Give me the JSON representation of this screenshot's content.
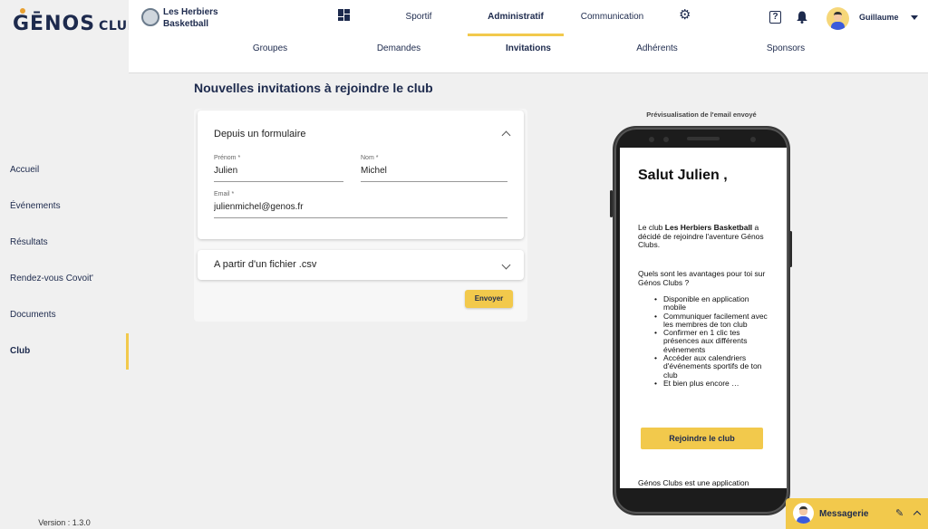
{
  "app": {
    "logo_main": "GĒNOS",
    "logo_sub": "CLUBS",
    "version": "Version : 1.3.0"
  },
  "sidebar": {
    "items": [
      {
        "label": "Accueil"
      },
      {
        "label": "Événements"
      },
      {
        "label": "Résultats"
      },
      {
        "label": "Rendez-vous Covoit'"
      },
      {
        "label": "Documents"
      },
      {
        "label": "Club",
        "active": true
      }
    ]
  },
  "header": {
    "club_name": "Les Herbiers Basketball",
    "tabs": [
      {
        "label": "Sportif"
      },
      {
        "label": "Administratif",
        "active": true
      },
      {
        "label": "Communication"
      }
    ],
    "user_name": "Guillaume",
    "help_glyph": "?",
    "icons": [
      "dashboard-icon",
      "gear-icon",
      "help-icon",
      "bell-icon",
      "avatar",
      "caret-down-icon"
    ]
  },
  "subnav": {
    "tabs": [
      {
        "label": "Groupes"
      },
      {
        "label": "Demandes"
      },
      {
        "label": "Invitations",
        "active": true
      },
      {
        "label": "Adhérents"
      },
      {
        "label": "Sponsors"
      }
    ]
  },
  "main": {
    "title": "Nouvelles invitations à rejoindre le club",
    "form_section": {
      "title": "Depuis un formulaire",
      "expanded": true,
      "first_name_label": "Prénom *",
      "first_name_value": "Julien",
      "last_name_label": "Nom *",
      "last_name_value": "Michel",
      "email_label": "Email *",
      "email_value": "julienmichel@genos.fr"
    },
    "csv_section": {
      "title": "A partir d'un fichier .csv",
      "expanded": false
    },
    "send_button": "Envoyer"
  },
  "preview": {
    "label": "Prévisualisation de l'email envoyé",
    "greeting": "Salut Julien ,",
    "intro_prefix": "Le club ",
    "intro_club": "Les Herbiers Basketball",
    "intro_suffix": " a décidé de rejoindre l'aventure Génos Clubs.",
    "question": "Quels sont les avantages pour toi sur Génos Clubs ?",
    "benefits": [
      "Disponible en application mobile",
      "Communiquer facilement avec les membres de ton club",
      "Confirmer en 1 clic tes présences aux différents événements",
      "Accéder aux calendriers d'événements sportifs de ton club",
      "Et bien plus encore …"
    ],
    "join_button": "Rejoindre le club",
    "footer": "Génos Clubs est une application"
  },
  "messenger": {
    "label": "Messagerie"
  },
  "colors": {
    "accent": "#f2c94c",
    "navy": "#1d2a4d",
    "background": "#f0f0f0"
  }
}
